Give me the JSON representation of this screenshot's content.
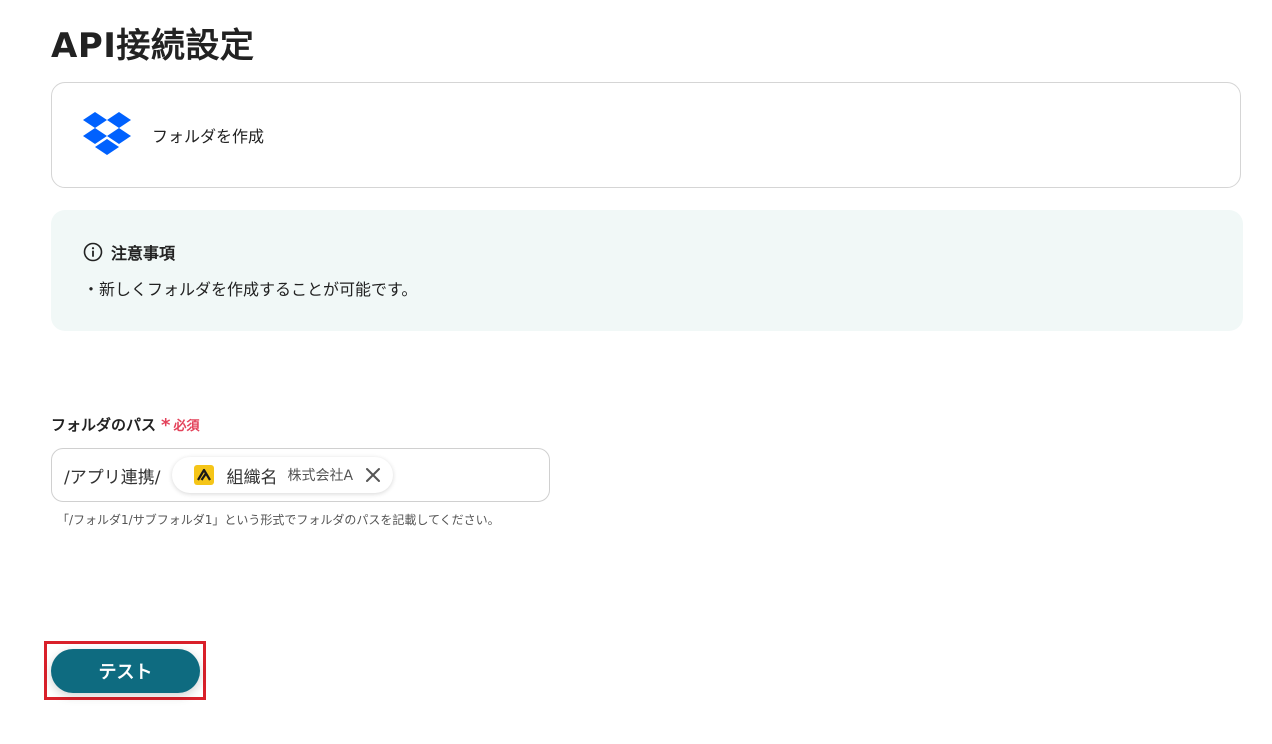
{
  "page": {
    "title": "API接続設定"
  },
  "action": {
    "app_icon": "dropbox-icon",
    "label": "フォルダを作成"
  },
  "notice": {
    "icon": "info-icon",
    "title": "注意事項",
    "body": "・新しくフォルダを作成することが可能です。"
  },
  "folder_path_field": {
    "label": "フォルダのパス",
    "required_mark": "*",
    "required_text": "必須",
    "prefix": "/アプリ連携/",
    "chip": {
      "icon": "yoom-icon",
      "label": "組織名",
      "value": "株式会社A",
      "remove_icon": "close-icon"
    },
    "helper": "「/フォルダ1/サブフォルダ1」という形式でフォルダのパスを記載してください。"
  },
  "buttons": {
    "test_label": "テスト"
  },
  "colors": {
    "accent": "#0e6b80",
    "required": "#e3435b",
    "highlight": "#d9202a",
    "dropbox": "#0061fe",
    "notice_bg": "#f1f8f7"
  }
}
